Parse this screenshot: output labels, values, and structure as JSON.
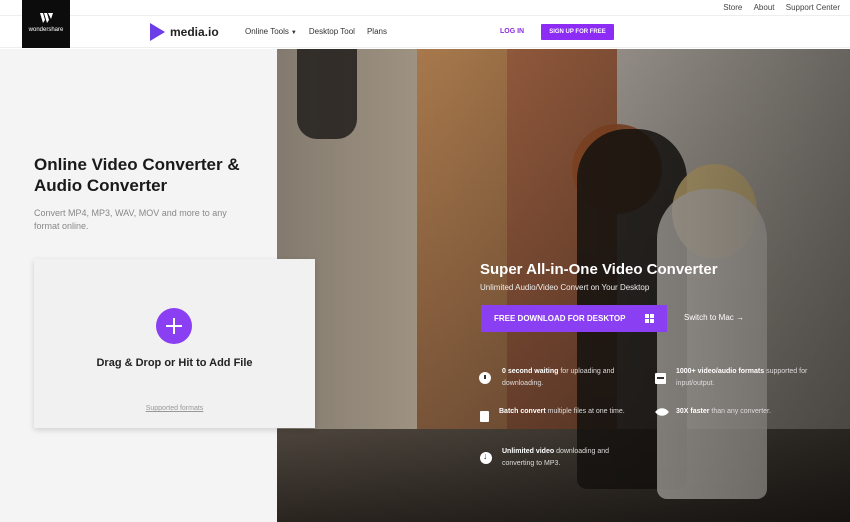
{
  "utility": {
    "links": [
      "Store",
      "About",
      "Support Center"
    ]
  },
  "header": {
    "brand_logo_text": "wondershare",
    "product_name": "media.io",
    "nav": [
      {
        "label": "Online Tools",
        "has_dropdown": true
      },
      {
        "label": "Desktop Tool",
        "has_dropdown": false
      },
      {
        "label": "Plans",
        "has_dropdown": false
      }
    ],
    "login_label": "LOG IN",
    "signup_label": "SIGN UP FOR FREE"
  },
  "left": {
    "title": "Online Video Converter & Audio Converter",
    "subtitle": "Convert MP4, MP3, WAV, MOV and more to any format online.",
    "drop_label": "Drag & Drop or Hit to Add File",
    "supported_link": "Supported formats"
  },
  "hero": {
    "title": "Super All-in-One Video Converter",
    "subtitle": "Unlimited Audio/Video Convert on Your Desktop",
    "download_label": "FREE DOWNLOAD FOR DESKTOP",
    "switch_label": "Switch to Mac →",
    "features": [
      {
        "icon": "clock-icon",
        "bold": "0 second waiting",
        "text": " for uploading and downloading."
      },
      {
        "icon": "film-icon",
        "bold": "1000+ video/audio formats",
        "text": " supported for input/output."
      },
      {
        "icon": "document-icon",
        "bold": "Batch convert",
        "text": " multiple files at one time."
      },
      {
        "icon": "rocket-icon",
        "bold": "30X faster",
        "text": " than any converter."
      },
      {
        "icon": "download-icon",
        "bold": "Unlimited video",
        "text": " downloading and converting to MP3."
      }
    ]
  },
  "colors": {
    "accent": "#8a3ff2",
    "signup": "#8c2cf5",
    "login_text": "#8a2be2"
  }
}
